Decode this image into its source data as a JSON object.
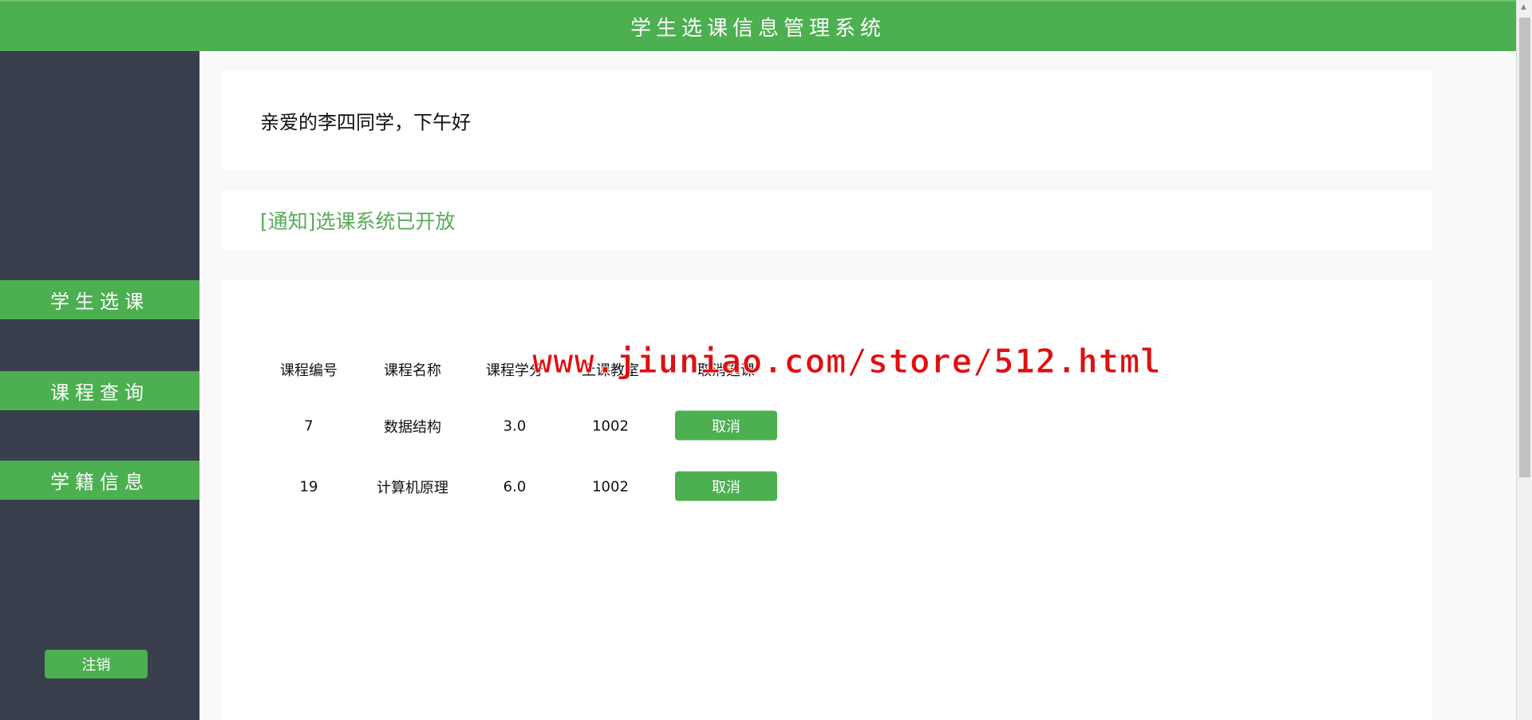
{
  "header": {
    "title": "学生选课信息管理系统"
  },
  "sidebar": {
    "items": [
      {
        "label": "学生选课"
      },
      {
        "label": "课程查询"
      },
      {
        "label": "学籍信息"
      }
    ],
    "logout": "注销"
  },
  "greeting": "亲爱的李四同学，下午好",
  "notice": "[通知]选课系统已开放",
  "table": {
    "headers": [
      "课程编号",
      "课程名称",
      "课程学分",
      "上课教室",
      "取消选课"
    ],
    "rows": [
      {
        "id": "7",
        "name": "数据结构",
        "credit": "3.0",
        "room": "1002",
        "action": "取消"
      },
      {
        "id": "19",
        "name": "计算机原理",
        "credit": "6.0",
        "room": "1002",
        "action": "取消"
      }
    ]
  },
  "watermark": "www.jiuniao.com/store/512.html"
}
